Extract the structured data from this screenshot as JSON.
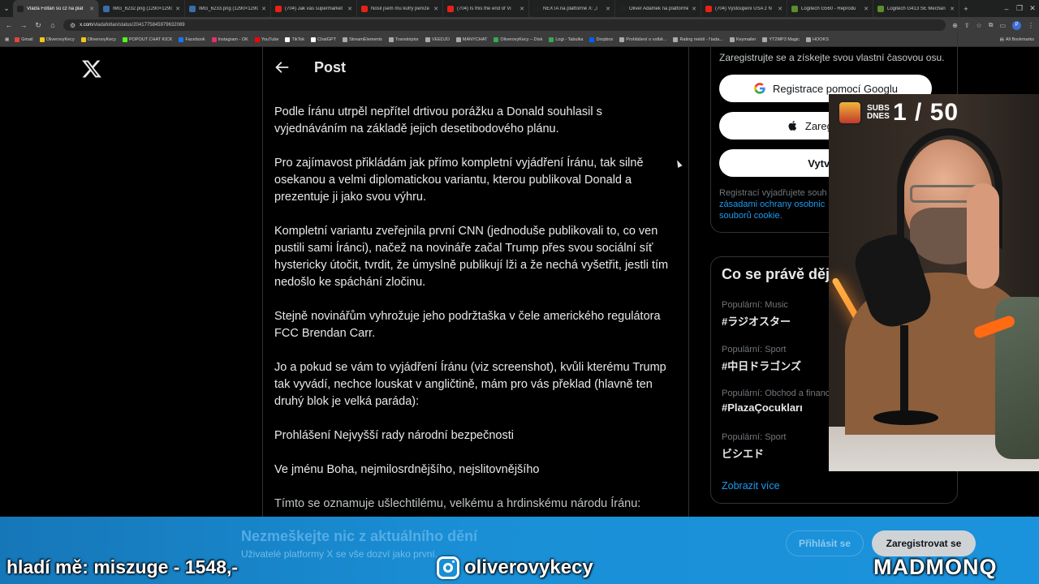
{
  "browser": {
    "tabs": [
      {
        "title": "Vláďa Foltán sú cz na plat",
        "color": "#222222",
        "active": true
      },
      {
        "title": "IMG_6232.png (1290×1290)",
        "color": "#3a6ea5",
        "active": false
      },
      {
        "title": "IMG_6233.png (1290×1290)",
        "color": "#3a6ea5",
        "active": false
      },
      {
        "title": "(704) Jak vás supermarket",
        "color": "#e62117",
        "active": false
      },
      {
        "title": "Nosil jsem mu kufry peníze",
        "color": "#e62117",
        "active": false
      },
      {
        "title": "(704) Is this the end of Vi",
        "color": "#e62117",
        "active": false
      },
      {
        "title": "NEXTA na platformě X: „I",
        "color": "#222222",
        "active": false
      },
      {
        "title": "Oliver Adámek na platformě",
        "color": "#222222",
        "active": false
      },
      {
        "title": "(704) Vystoupení USA z N",
        "color": "#e62117",
        "active": false
      },
      {
        "title": "Logitech G560 - Reprodu",
        "color": "#5a8f2c",
        "active": false
      },
      {
        "title": "Logitech G413 SE Mechan",
        "color": "#5a8f2c",
        "active": false
      }
    ],
    "url": {
      "host": "x.com",
      "path": "/vladafoltan/status/2041775845979632069"
    },
    "bookmarks": [
      {
        "label": "Gmail",
        "color": "#ea4335"
      },
      {
        "label": "OliverovyKecy",
        "color": "#f5c518"
      },
      {
        "label": "OliverovyKecy",
        "color": "#f5c518"
      },
      {
        "label": "POPOUT CHAT KICK",
        "color": "#53fc18"
      },
      {
        "label": "Facebook",
        "color": "#1877f2"
      },
      {
        "label": "Instagram - OK",
        "color": "#e1306c"
      },
      {
        "label": "YouTube",
        "color": "#ff0000"
      },
      {
        "label": "TikTok",
        "color": "#ffffff"
      },
      {
        "label": "ChatGPT",
        "color": "#ffffff"
      },
      {
        "label": "StreamElements",
        "color": "#aaaaaa"
      },
      {
        "label": "Transkriptor",
        "color": "#aaaaaa"
      },
      {
        "label": "VEEDJO",
        "color": "#aaaaaa"
      },
      {
        "label": "MANYCHAT",
        "color": "#aaaaaa"
      },
      {
        "label": "OliverovyKecy – Disk",
        "color": "#34a853"
      },
      {
        "label": "Logi - Tabulka",
        "color": "#34a853"
      },
      {
        "label": "Dropbox",
        "color": "#0061ff"
      },
      {
        "label": "Prohlášení o volbě...",
        "color": "#aaaaaa"
      },
      {
        "label": "Rating médií - Nada...",
        "color": "#aaaaaa"
      },
      {
        "label": "Keymailer",
        "color": "#aaaaaa"
      },
      {
        "label": "YT2MP3 Magic",
        "color": "#aaaaaa"
      },
      {
        "label": "HOOKS",
        "color": "#aaaaaa"
      }
    ],
    "all_bookmarks": "All Bookmarks",
    "profile_initial": "P"
  },
  "post": {
    "header": "Post",
    "paragraphs": [
      "Podle Íránu utrpěl nepřítel drtivou porážku a Donald souhlasil s\nvyjednáváním na základě jejich desetibodového plánu.",
      "Pro zajímavost přikládám jak přímo kompletní vyjádření Íránu, tak silně\nosekanou  a velmi diplomatickou variantu, kterou publikoval Donald a\nprezentuje ji jako svou výhru.",
      "Kompletní variantu zveřejnila první CNN (jednoduše publikovali to, co ven\npustili sami Íránci), načež na novináře začal Trump přes svou sociální síť\nhystericky útočit, tvrdit, že úmyslně publikují lži a že nechá vyšetřit, jestli tím\nnedošlo ke spáchání zločinu.",
      "Stejně novinářům vyhrožuje jeho podržtaška v čele amerického regulátora\nFCC Brendan Carr.",
      "Jo a pokud se vám to vyjádření Íránu (viz screenshot), kvůli kterému Trump\ntak vyvádí, nechce louskat v angličtině, mám pro vás překlad (hlavně ten\ndruhý blok je velká paráda):",
      "Prohlášení Nejvyšší rady národní bezpečnosti",
      "Ve jménu Boha, nejmilosrdnějšího, nejslitovnějšího",
      "Tímto se oznamuje ušlechtilému, velkému a hrdinskému národu Íránu:"
    ]
  },
  "sidebar": {
    "signup_prompt": "Zaregistrujte se a získejte svou vlastní časovou osu.",
    "google_button": "Registrace pomocí Googlu",
    "apple_button": "Zaregistrova",
    "create_button": "Vytvoři",
    "legal_text": "Registrací vyjadřujete souh",
    "legal_link1": "zásadami ochrany osobnic",
    "legal_link2": "souborů cookie.",
    "trends_title": "Co se právě děj",
    "trends": [
      {
        "meta": "Populární: Music",
        "tag": "#ラジオスター"
      },
      {
        "meta": "Populární: Sport",
        "tag": "#中日ドラゴンズ"
      },
      {
        "meta": "Populární: Obchod a financ",
        "tag": "#PlazaÇocukları"
      },
      {
        "meta": "Populární: Sport",
        "tag": "ビシエド"
      }
    ],
    "show_more": "Zobrazit více"
  },
  "banner": {
    "title": "Nezmeškejte nic z aktuálního dění",
    "subtitle": "Uživatelé platformy X se vše dozví jako první.",
    "login": "Přihlásit se",
    "signup": "Zaregistrovat se"
  },
  "stream": {
    "subs_label": "SUBS DNES",
    "subs_count": "1 / 50",
    "left_text": "hladí mě: miszuge - 1548,-",
    "instagram": "oliverovykecy",
    "right_text": "MADMONQ"
  }
}
